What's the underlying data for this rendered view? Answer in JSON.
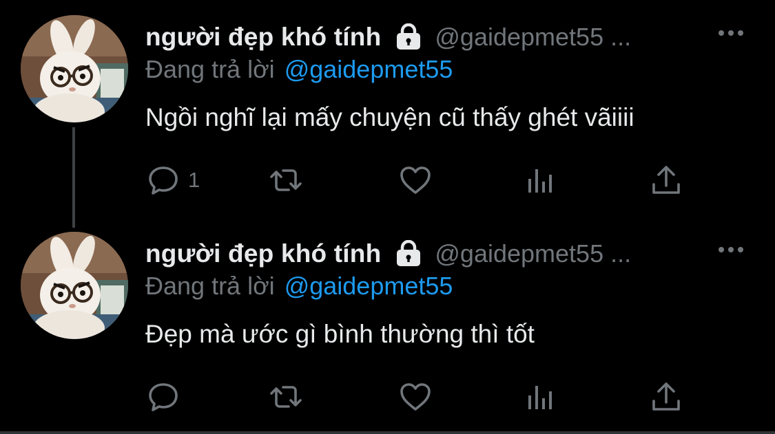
{
  "colors": {
    "background": "#000000",
    "primary_text": "#e7e9ea",
    "secondary_text": "#71767b",
    "accent": "#1d9bf0",
    "thread_line": "#3e4144"
  },
  "tweets": [
    {
      "display_name": "người đẹp khó tính",
      "lock_icon": "lock-icon",
      "handle": "@gaidepmet55 ...",
      "more_icon": "more-horizontal-icon",
      "reply_prefix": "Đang trả lời",
      "reply_to": "@gaidepmet55",
      "text": "Ngồi nghĩ lại mấy chuyện cũ thấy ghét vãiiii",
      "reply_count": "1",
      "retweet_count": "",
      "like_count": "",
      "avatar": "bunny-with-glasses-avatar"
    },
    {
      "display_name": "người đẹp khó tính",
      "lock_icon": "lock-icon",
      "handle": "@gaidepmet55 ...",
      "more_icon": "more-horizontal-icon",
      "reply_prefix": "Đang trả lời",
      "reply_to": "@gaidepmet55",
      "text": "Đẹp mà ước gì bình thường thì tốt",
      "reply_count": "",
      "retweet_count": "",
      "like_count": "",
      "avatar": "bunny-with-glasses-avatar"
    }
  ],
  "action_icons": [
    "reply-icon",
    "retweet-icon",
    "like-icon",
    "views-icon",
    "share-icon"
  ]
}
